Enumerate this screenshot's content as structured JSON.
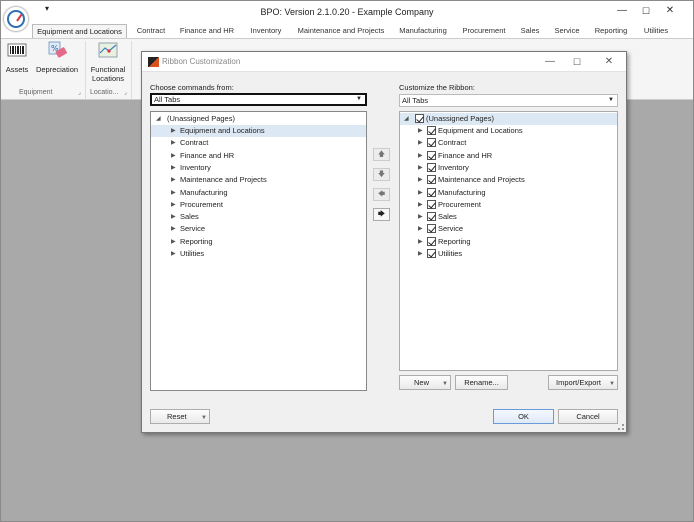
{
  "app": {
    "title": "BPO: Version 2.1.0.20 - Example Company",
    "qat_icon": "dropdown-arrow",
    "window_controls": [
      "—",
      "☐",
      "✕"
    ]
  },
  "tabs": [
    "Equipment and Locations",
    "Contract",
    "Finance and HR",
    "Inventory",
    "Maintenance and Projects",
    "Manufacturing",
    "Procurement",
    "Sales",
    "Service",
    "Reporting",
    "Utilities"
  ],
  "ribbon": {
    "assets_label": "Assets",
    "depreciation_label": "Depreciation",
    "functional_line1": "Functional",
    "functional_line2": "Locations",
    "group_equipment": "Equipment",
    "group_locations": "Locatio..."
  },
  "dialog": {
    "title": "Ribbon Customization",
    "choose_label": "Choose commands from:",
    "choose_value": "All Tabs",
    "customize_label": "Customize the Ribbon:",
    "customize_value": "All Tabs",
    "left_items": {
      "root": "(Unassigned Pages)",
      "items": [
        "Equipment and Locations",
        "Contract",
        "Finance and HR",
        "Inventory",
        "Maintenance and Projects",
        "Manufacturing",
        "Procurement",
        "Sales",
        "Service",
        "Reporting",
        "Utilities"
      ]
    },
    "right_items": {
      "root": "(Unassigned Pages)",
      "items": [
        "Equipment and Locations",
        "Contract",
        "Finance and HR",
        "Inventory",
        "Maintenance and Projects",
        "Manufacturing",
        "Procurement",
        "Sales",
        "Service",
        "Reporting",
        "Utilities"
      ]
    },
    "move_buttons": [
      "🡅",
      "🡇",
      "🡄",
      "🡆"
    ],
    "new_label": "New",
    "rename_label": "Rename...",
    "import_export_label": "Import/Export",
    "reset_label": "Reset",
    "ok_label": "OK",
    "cancel_label": "Cancel"
  }
}
